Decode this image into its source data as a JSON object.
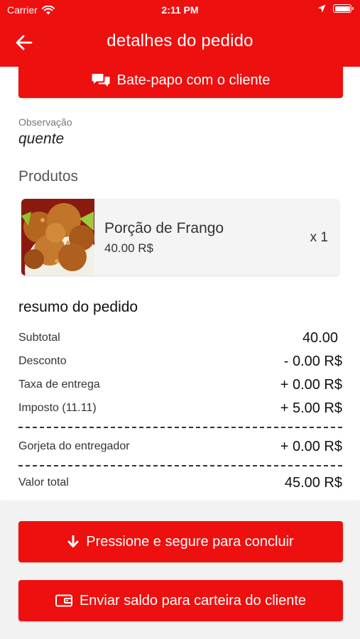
{
  "status_bar": {
    "carrier": "Carrier",
    "time": "2:11 PM"
  },
  "header": {
    "title": "detalhes do pedido",
    "back_icon": "arrow-left-icon"
  },
  "chat_button": {
    "label": "Bate-papo com o cliente",
    "icon": "chat-bubbles-icon"
  },
  "observation": {
    "label": "Observação",
    "value": "quente"
  },
  "products": {
    "section_title": "Produtos",
    "items": [
      {
        "name": "Porção de Frango",
        "price": "40.00 R$",
        "quantity": "x 1"
      }
    ]
  },
  "summary": {
    "title": "resumo do pedido",
    "rows": [
      {
        "label": "Subtotal",
        "value": "40.00"
      },
      {
        "label": "Desconto",
        "value": "- 0.00 R$"
      },
      {
        "label": "Taxa de entrega",
        "value": "+ 0.00 R$"
      },
      {
        "label": "Imposto (11.11)",
        "value": "+ 5.00 R$"
      }
    ],
    "tip": {
      "label": "Gorjeta do entregador",
      "value": "+ 0.00 R$"
    },
    "total": {
      "label": "Valor total",
      "value": "45.00 R$"
    }
  },
  "actions": {
    "complete": {
      "label": "Pressione e segure para concluir",
      "icon": "arrow-down-icon"
    },
    "wallet": {
      "label": "Enviar saldo para carteira do cliente",
      "icon": "wallet-icon"
    }
  },
  "colors": {
    "primary": "#ee0f0f",
    "card_bg": "#f4f4f4",
    "panel_bg": "#f2f2f2"
  }
}
